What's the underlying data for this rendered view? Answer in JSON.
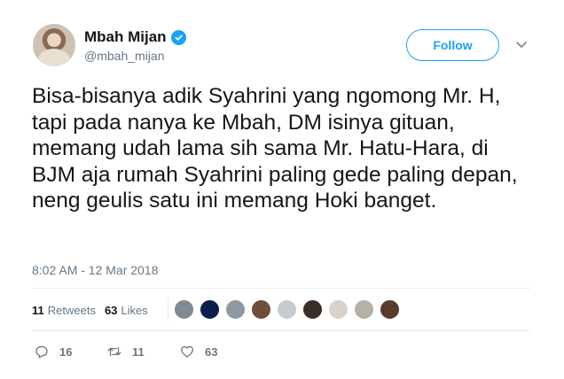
{
  "author": {
    "display_name": "Mbah Mijan",
    "handle": "@mbah_mijan",
    "verified_icon": "verified-badge-icon"
  },
  "follow_label": "Follow",
  "tweet": {
    "text": "Bisa-bisanya adik Syahrini yang ngomong Mr. H, tapi pada nanya ke Mbah, DM isinya gituan, memang udah lama sih sama Mr. Hatu-Hara, di BJM aja rumah Syahrini paling gede paling depan, neng geulis satu ini memang Hoki banget.",
    "timestamp": "8:02 AM - 12 Mar 2018"
  },
  "stats": {
    "retweets_count": "11",
    "retweets_label": "Retweets",
    "likes_count": "63",
    "likes_label": "Likes"
  },
  "likers": [
    {
      "color": "#7f8a92"
    },
    {
      "color": "#0b1f4a"
    },
    {
      "color": "#8e9aa3"
    },
    {
      "color": "#6f4e3a"
    },
    {
      "color": "#c7ccd1"
    },
    {
      "color": "#3a2e28"
    },
    {
      "color": "#d9d2cc"
    },
    {
      "color": "#b7b0a6"
    },
    {
      "color": "#5a3b2c"
    }
  ],
  "actions": {
    "replies": "16",
    "retweets": "11",
    "likes": "63"
  },
  "colors": {
    "accent": "#1da1f2",
    "text": "#14171a",
    "muted": "#657786"
  }
}
